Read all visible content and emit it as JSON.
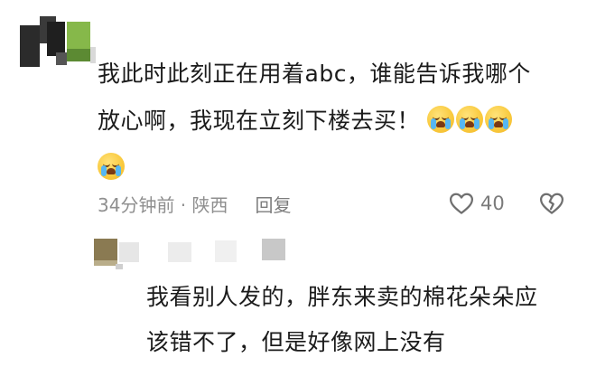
{
  "comment": {
    "line1": "我此时此刻正在用着abc，谁能告诉我哪个",
    "line2": "放心啊，我现在立刻下楼去买！",
    "emoji_name": "crying-face-icon",
    "emoji_count_line2": 3,
    "emoji_count_line3": 1,
    "time_location": "34分钟前 · 陕西",
    "reply_label": "回复",
    "like_count": "40"
  },
  "reply": {
    "line1": "我看别人发的，胖东来卖的棉花朵朵应",
    "line2": "该错不了，但是好像网上没有"
  },
  "colors": {
    "text": "#1b1b1b",
    "meta": "#8f8f8f",
    "emoji": "#f9c93c",
    "tear": "#56b7f2"
  }
}
